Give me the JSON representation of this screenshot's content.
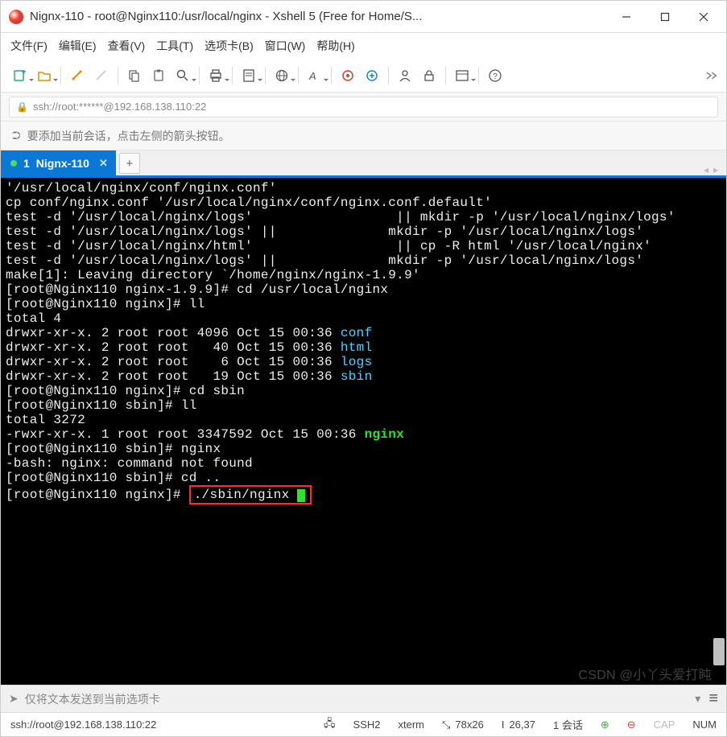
{
  "window": {
    "title": "Nignx-110 - root@Nginx110:/usr/local/nginx - Xshell 5 (Free for Home/S..."
  },
  "menu": {
    "file": "文件(F)",
    "edit": "编辑(E)",
    "view": "查看(V)",
    "tools": "工具(T)",
    "tabs": "选项卡(B)",
    "window": "窗口(W)",
    "help": "帮助(H)"
  },
  "address": {
    "url": "ssh://root:******@192.168.138.110:22"
  },
  "hint": {
    "text": "要添加当前会话，点击左侧的箭头按钮。"
  },
  "tabs": {
    "active": {
      "index": "1",
      "name": "Nignx-110"
    }
  },
  "terminal": {
    "lines": [
      {
        "t": "plain",
        "text": "'/usr/local/nginx/conf/nginx.conf'"
      },
      {
        "t": "plain",
        "text": "cp conf/nginx.conf '/usr/local/nginx/conf/nginx.conf.default'"
      },
      {
        "t": "plain",
        "text": "test -d '/usr/local/nginx/logs'                  || mkdir -p '/usr/local/nginx/logs'"
      },
      {
        "t": "plain",
        "text": "test -d '/usr/local/nginx/logs' ||              mkdir -p '/usr/local/nginx/logs'"
      },
      {
        "t": "plain",
        "text": "test -d '/usr/local/nginx/html'                  || cp -R html '/usr/local/nginx'"
      },
      {
        "t": "plain",
        "text": "test -d '/usr/local/nginx/logs' ||              mkdir -p '/usr/local/nginx/logs'"
      },
      {
        "t": "plain",
        "text": "make[1]: Leaving directory `/home/nginx/nginx-1.9.9'"
      },
      {
        "t": "prompt",
        "prompt": "[root@Nginx110 nginx-1.9.9]# ",
        "cmd": "cd /usr/local/nginx"
      },
      {
        "t": "prompt",
        "prompt": "[root@Nginx110 nginx]# ",
        "cmd": "ll"
      },
      {
        "t": "plain",
        "text": "total 4"
      },
      {
        "t": "ls",
        "perm": "drwxr-xr-x. 2 root root 4096 Oct 15 00:36 ",
        "name": "conf"
      },
      {
        "t": "ls",
        "perm": "drwxr-xr-x. 2 root root   40 Oct 15 00:36 ",
        "name": "html"
      },
      {
        "t": "ls",
        "perm": "drwxr-xr-x. 2 root root    6 Oct 15 00:36 ",
        "name": "logs"
      },
      {
        "t": "ls",
        "perm": "drwxr-xr-x. 2 root root   19 Oct 15 00:36 ",
        "name": "sbin"
      },
      {
        "t": "prompt",
        "prompt": "[root@Nginx110 nginx]# ",
        "cmd": "cd sbin"
      },
      {
        "t": "prompt",
        "prompt": "[root@Nginx110 sbin]# ",
        "cmd": "ll"
      },
      {
        "t": "plain",
        "text": "total 3272"
      },
      {
        "t": "lsg",
        "perm": "-rwxr-xr-x. 1 root root 3347592 Oct 15 00:36 ",
        "name": "nginx"
      },
      {
        "t": "prompt",
        "prompt": "[root@Nginx110 sbin]# ",
        "cmd": "nginx"
      },
      {
        "t": "plain",
        "text": "-bash: nginx: command not found"
      },
      {
        "t": "prompt",
        "prompt": "[root@Nginx110 sbin]# ",
        "cmd": "cd .."
      },
      {
        "t": "prompt-hl",
        "prompt": "[root@Nginx110 nginx]# ",
        "cmd": "./sbin/nginx "
      }
    ]
  },
  "send": {
    "placeholder": "仅将文本发送到当前选项卡"
  },
  "status": {
    "conn": "ssh://root@192.168.138.110:22",
    "proto": "SSH2",
    "term": "xterm",
    "size": "78x26",
    "pos": "26,37",
    "sess": "1 会话",
    "caps": "CAP",
    "num": "NUM"
  },
  "watermark": "CSDN @小丫头爱打盹"
}
